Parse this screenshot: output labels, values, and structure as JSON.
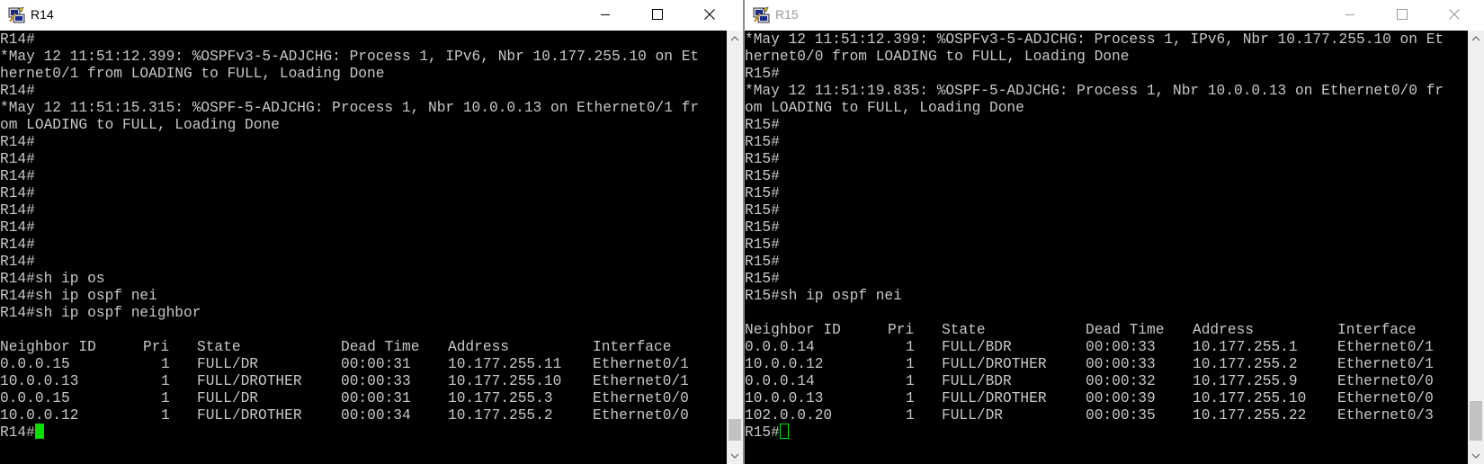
{
  "left": {
    "title": "R14",
    "lines": [
      "R14#",
      "*May 12 11:51:12.399: %OSPFv3-5-ADJCHG: Process 1, IPv6, Nbr 10.177.255.10 on Et",
      "hernet0/1 from LOADING to FULL, Loading Done",
      "R14#",
      "*May 12 11:51:15.315: %OSPF-5-ADJCHG: Process 1, Nbr 10.0.0.13 on Ethernet0/1 fr",
      "om LOADING to FULL, Loading Done",
      "R14#",
      "R14#",
      "R14#",
      "R14#",
      "R14#",
      "R14#",
      "R14#",
      "R14#",
      "R14#sh ip os",
      "R14#sh ip ospf nei",
      "R14#sh ip ospf neighbor",
      ""
    ],
    "table": {
      "headers": [
        "Neighbor ID",
        "Pri",
        "State",
        "Dead Time",
        "Address",
        "Interface"
      ],
      "rows": [
        [
          "0.0.0.15",
          "1",
          "FULL/DR",
          "00:00:31",
          "10.177.255.11",
          "Ethernet0/1"
        ],
        [
          "10.0.0.13",
          "1",
          "FULL/DROTHER",
          "00:00:33",
          "10.177.255.10",
          "Ethernet0/1"
        ],
        [
          "0.0.0.15",
          "1",
          "FULL/DR",
          "00:00:31",
          "10.177.255.3",
          "Ethernet0/0"
        ],
        [
          "10.0.0.12",
          "1",
          "FULL/DROTHER",
          "00:00:34",
          "10.177.255.2",
          "Ethernet0/0"
        ]
      ]
    },
    "prompt": "R14#"
  },
  "right": {
    "title": "R15",
    "lines": [
      "*May 12 11:51:12.399: %OSPFv3-5-ADJCHG: Process 1, IPv6, Nbr 10.177.255.10 on Et",
      "hernet0/0 from LOADING to FULL, Loading Done",
      "R15#",
      "*May 12 11:51:19.835: %OSPF-5-ADJCHG: Process 1, Nbr 10.0.0.13 on Ethernet0/0 fr",
      "om LOADING to FULL, Loading Done",
      "R15#",
      "R15#",
      "R15#",
      "R15#",
      "R15#",
      "R15#",
      "R15#",
      "R15#",
      "R15#",
      "R15#",
      "R15#sh ip ospf nei",
      ""
    ],
    "table": {
      "headers": [
        "Neighbor ID",
        "Pri",
        "State",
        "Dead Time",
        "Address",
        "Interface"
      ],
      "rows": [
        [
          "0.0.0.14",
          "1",
          "FULL/BDR",
          "00:00:33",
          "10.177.255.1",
          "Ethernet0/1"
        ],
        [
          "10.0.0.12",
          "1",
          "FULL/DROTHER",
          "00:00:33",
          "10.177.255.2",
          "Ethernet0/1"
        ],
        [
          "0.0.0.14",
          "1",
          "FULL/BDR",
          "00:00:32",
          "10.177.255.9",
          "Ethernet0/0"
        ],
        [
          "10.0.0.13",
          "1",
          "FULL/DROTHER",
          "00:00:39",
          "10.177.255.10",
          "Ethernet0/0"
        ],
        [
          "102.0.0.20",
          "1",
          "FULL/DR",
          "00:00:35",
          "10.177.255.22",
          "Ethernet0/3"
        ]
      ]
    },
    "prompt": "R15#"
  },
  "colors": {
    "terminal_bg": "#000000",
    "terminal_text": "#c8c8c8",
    "cursor": "#00e000",
    "inactive_title": "#9a9a9a"
  },
  "icons": {
    "app": "putty-icon",
    "minimize": "minimize-icon",
    "maximize": "maximize-icon",
    "close": "close-icon"
  }
}
